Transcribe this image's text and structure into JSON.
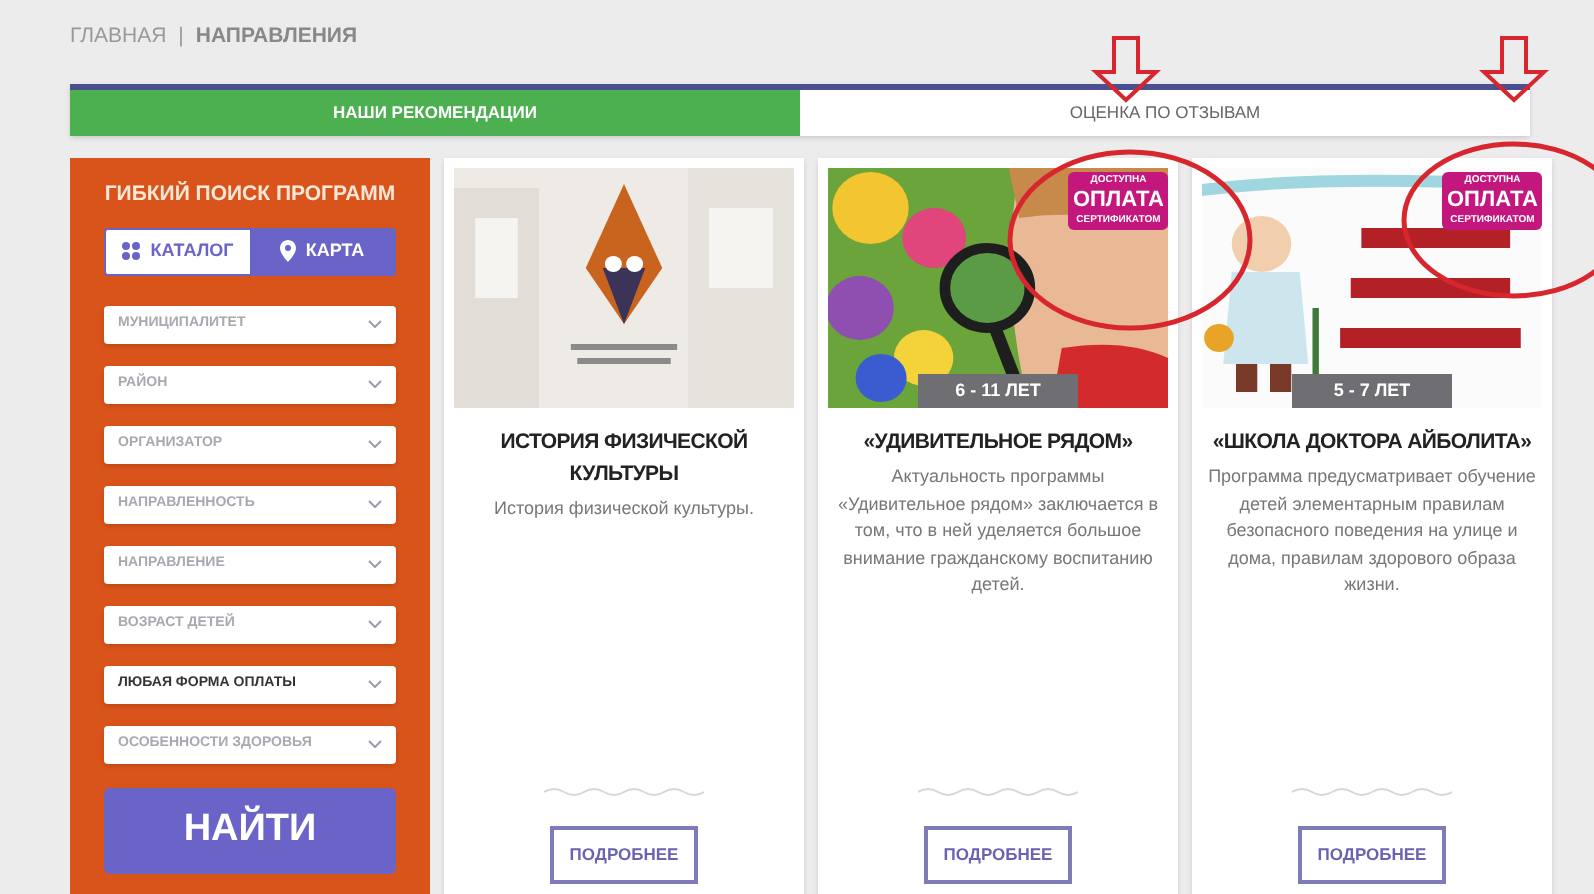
{
  "breadcrumb": [
    {
      "label": "ГЛАВНАЯ",
      "current": false
    },
    {
      "label": "НАПРАВЛЕНИЯ",
      "current": true
    }
  ],
  "breadcrumb_separator": "|",
  "tabs": [
    {
      "label": "НАШИ РЕКОМЕНДАЦИИ",
      "selected": true
    },
    {
      "label": "ОЦЕНКА ПО ОТЗЫВАМ",
      "selected": false
    }
  ],
  "filter_panel": {
    "title": "ГИБКИЙ ПОИСК ПРОГРАММ",
    "view_toggle": [
      {
        "label": "КАТАЛОГ",
        "kind": "grid",
        "selected": true
      },
      {
        "label": "КАРТА",
        "kind": "pin",
        "selected": false
      }
    ],
    "filters": [
      {
        "placeholder": "МУНИЦИПАЛИТЕТ"
      },
      {
        "placeholder": "РАЙОН"
      },
      {
        "placeholder": "ОРГАНИЗАТОР"
      },
      {
        "placeholder": "НАПРАВЛЕННОСТЬ"
      },
      {
        "placeholder": "НАПРАВЛЕНИЕ"
      },
      {
        "placeholder": "ВОЗРАСТ ДЕТЕЙ"
      },
      {
        "value": "ЛЮБАЯ ФОРМА ОПЛАТЫ"
      },
      {
        "placeholder": "ОСОБЕННОСТИ ЗДОРОВЬЯ"
      }
    ],
    "search_button": "НАЙТИ"
  },
  "cards": [
    {
      "image": {
        "kind": "picture"
      },
      "title": "ИСТОРИЯ ФИЗИЧЕСКОЙ КУЛЬТУРЫ",
      "description": "История физической культуры.",
      "button": "ПОДРОБНЕЕ"
    },
    {
      "image": {
        "kind": "picture"
      },
      "age": "6 - 11 ЛЕТ",
      "payment_badge": [
        "ДОСТУПНА",
        "ОПЛАТА",
        "СЕРТИФИКАТОМ"
      ],
      "title": "«УДИВИТЕЛЬНОЕ РЯДОМ»",
      "description": "Актуальность программы «Удивительное рядом» заключается в том, что в ней уделяется большое внимание гражданскому воспитанию детей.",
      "button": "ПОДРОБНЕЕ"
    },
    {
      "image": {
        "kind": "picture"
      },
      "age": "5 - 7 ЛЕТ",
      "payment_badge": [
        "ДОСТУПНА",
        "ОПЛАТА",
        "СЕРТИФИКАТОМ"
      ],
      "title": "«ШКОЛА ДОКТОРА АЙБОЛИТА»",
      "description": "Программа предусматривает обучение детей элементарным правилам безопасного поведения на улице и дома, правилам здорового образа жизни.",
      "button": "ПОДРОБНЕЕ"
    }
  ],
  "annotations": [
    {
      "kind": "arrow"
    },
    {
      "kind": "arrow"
    },
    {
      "kind": "circle"
    },
    {
      "kind": "circle"
    }
  ]
}
